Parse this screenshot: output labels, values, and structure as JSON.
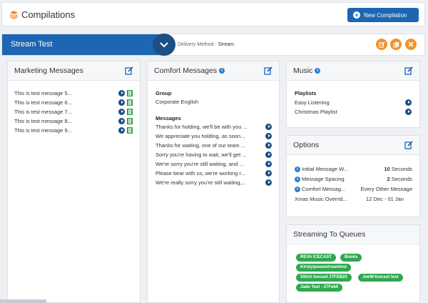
{
  "header": {
    "title": "Compilations",
    "new_button": "New Compilation"
  },
  "stream": {
    "name": "Stream Test",
    "delivery_label": "Delivery Method :",
    "delivery_value": "Stream"
  },
  "marketing": {
    "title": "Marketing Messages",
    "items": [
      "This is test message 5...",
      "This is test message 6...",
      "This is test message 7...",
      "This is test message 8...",
      "This is test message 9..."
    ]
  },
  "comfort": {
    "title": "Comfort Messages",
    "group_label": "Group",
    "group_value": "Corporate English",
    "messages_label": "Messages",
    "messages": [
      "Thanks for holding, we'll be with you ...",
      "We appreciate you holding, as soon...",
      "Thanks for waiting, one of our team ...",
      "Sorry you're having to wait, we'll get ...",
      "We're sorry you're still waiting, and ...",
      "Please bear with us, we're working r...",
      "We're really sorry you're still waiting,..."
    ]
  },
  "music": {
    "title": "Music",
    "playlists_label": "Playlists",
    "playlists": [
      "Easy Listening",
      "Christmas Playlist"
    ]
  },
  "options": {
    "title": "Options",
    "rows": [
      {
        "label": "Initial Message W...",
        "value_bold": "10",
        "value_rest": " Seconds"
      },
      {
        "label": "Message Spacing",
        "value_bold": "2",
        "value_rest": " Seconds"
      },
      {
        "label": "Comfort Messag...",
        "value_bold": "",
        "value_rest": "Every Other Message"
      },
      {
        "label": "Xmas Music Overrid...",
        "value_bold": "",
        "value_rest": "12 Dec - 01 Jan"
      }
    ]
  },
  "queues": {
    "title": "Streaming To Queues",
    "tags": [
      "REVA ICECAST",
      "Books",
      "Kirstyqueuestreamtest",
      "Stitch Icecast 27FEB20",
      "JoeW-Icecast test",
      "Jade Test - 27Feb0"
    ]
  },
  "colors": {
    "primary": "#1d66b3",
    "accent": "#f0922b",
    "tag": "#2fa84f"
  }
}
